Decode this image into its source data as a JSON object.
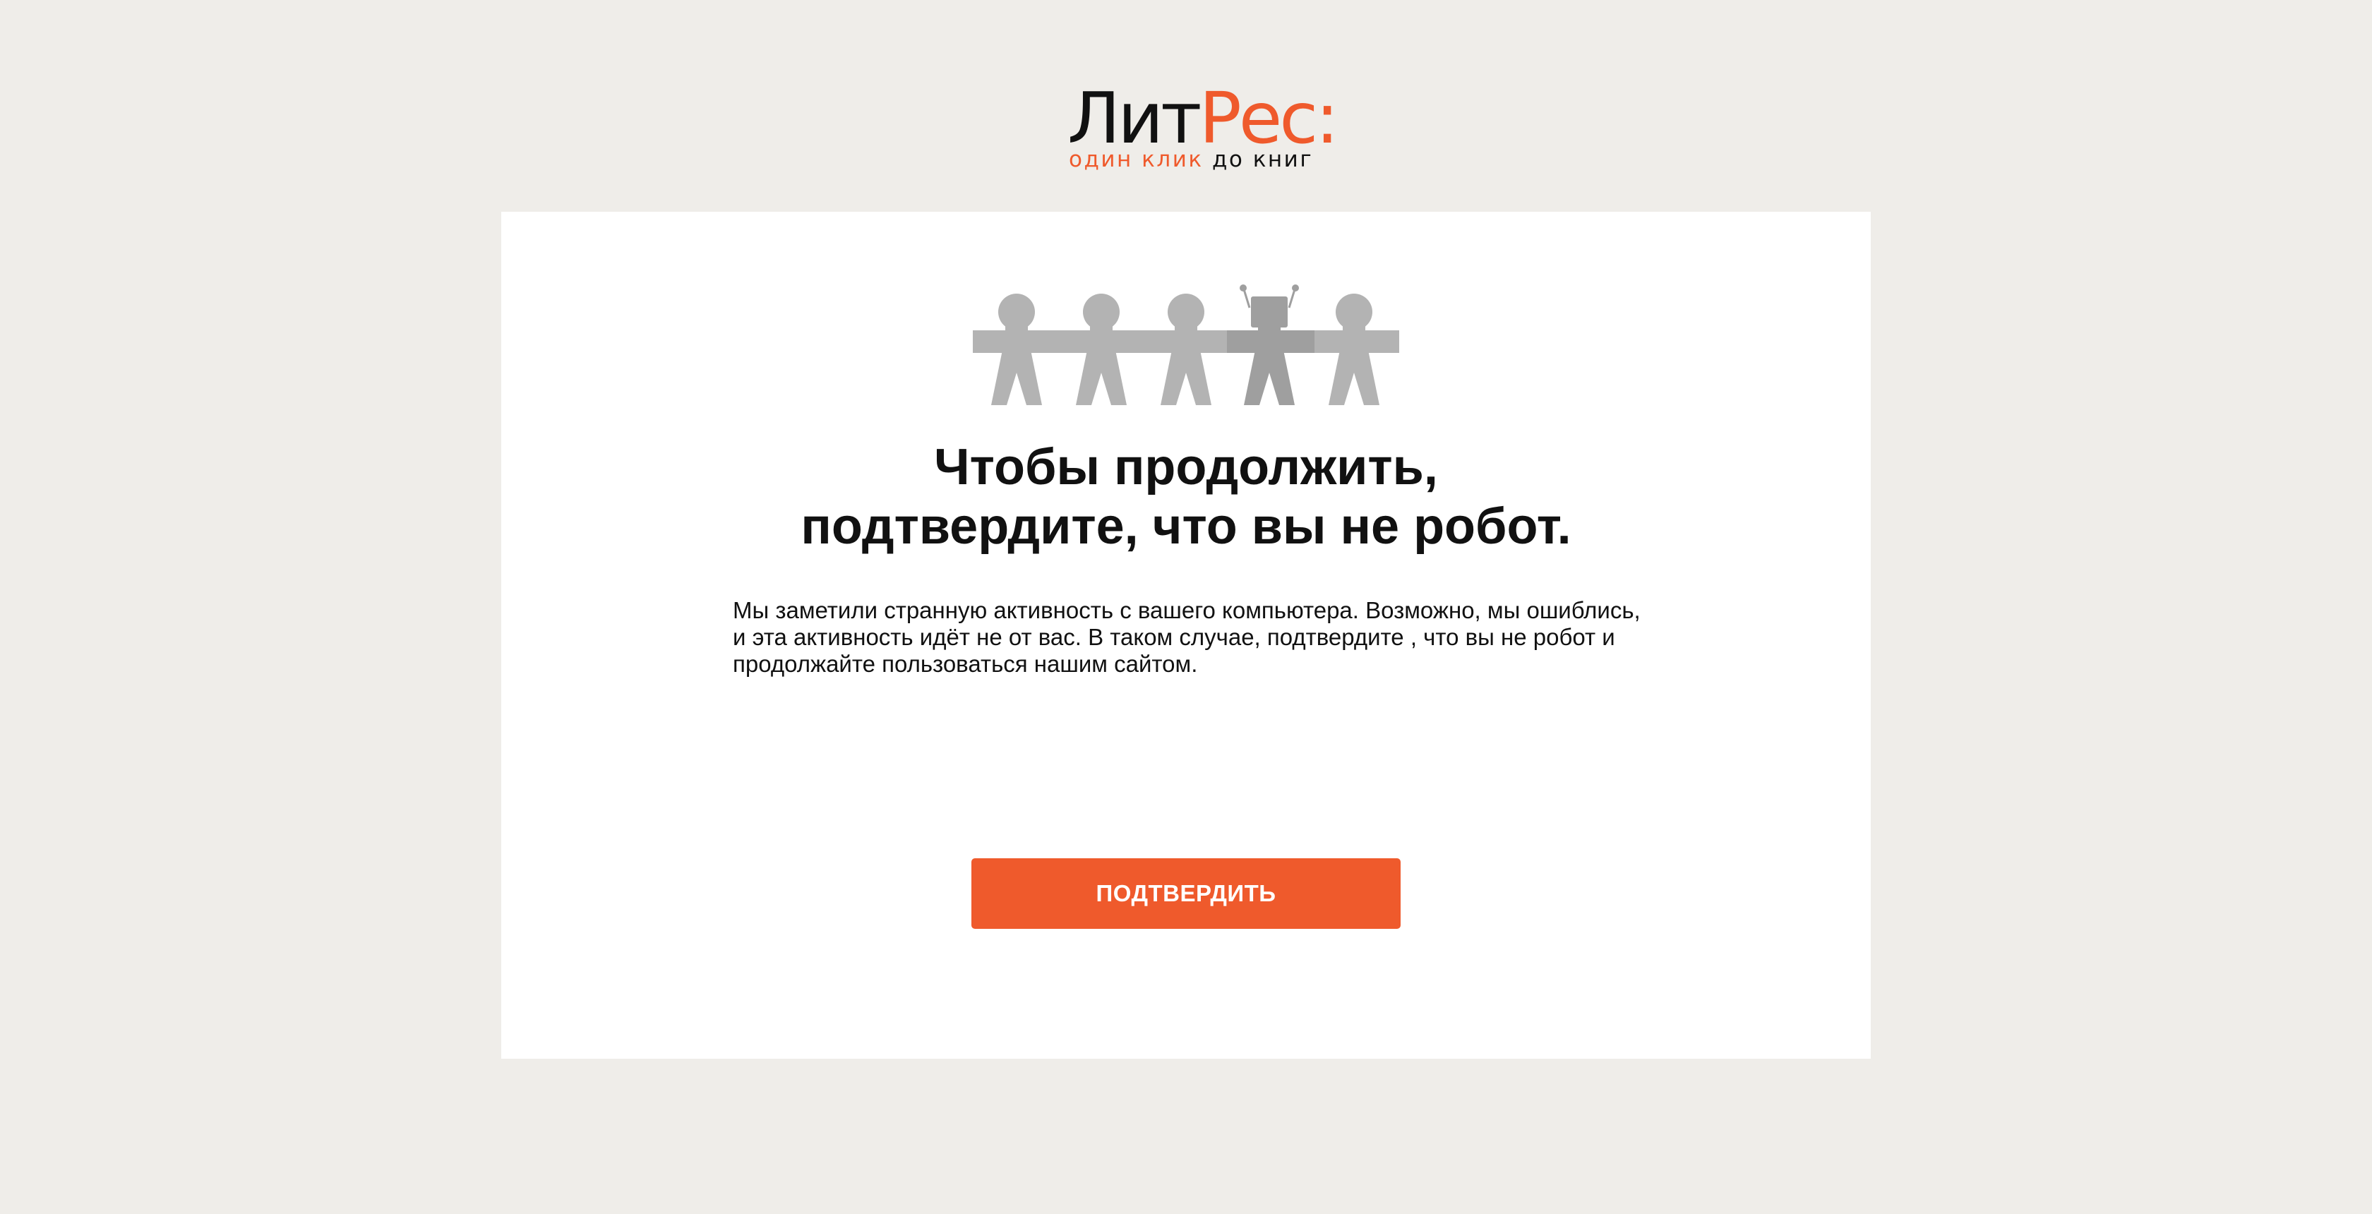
{
  "logo": {
    "name_part1": "Лит",
    "name_part2": "Рес:",
    "tagline_part1": "один клик",
    "tagline_part2": "до книг"
  },
  "main": {
    "illustration_icon": "paper-chain-people-with-robot-icon",
    "title_line1": "Чтобы продолжить,",
    "title_line2": "подтвердите, что вы не робот.",
    "description": "Мы заметили странную активность с вашего компьютера. Возможно, мы ошиблись, и эта активность идёт не от вас. В таком случае, подтвердите , что вы не робот и продолжайте пользоваться нашим сайтом.",
    "confirm_button_label": "ПОДТВЕРДИТЬ"
  },
  "colors": {
    "background": "#efede9",
    "card": "#ffffff",
    "accent": "#ef5a2c",
    "text": "#111111",
    "figure_gray": "#b3b3b3"
  }
}
